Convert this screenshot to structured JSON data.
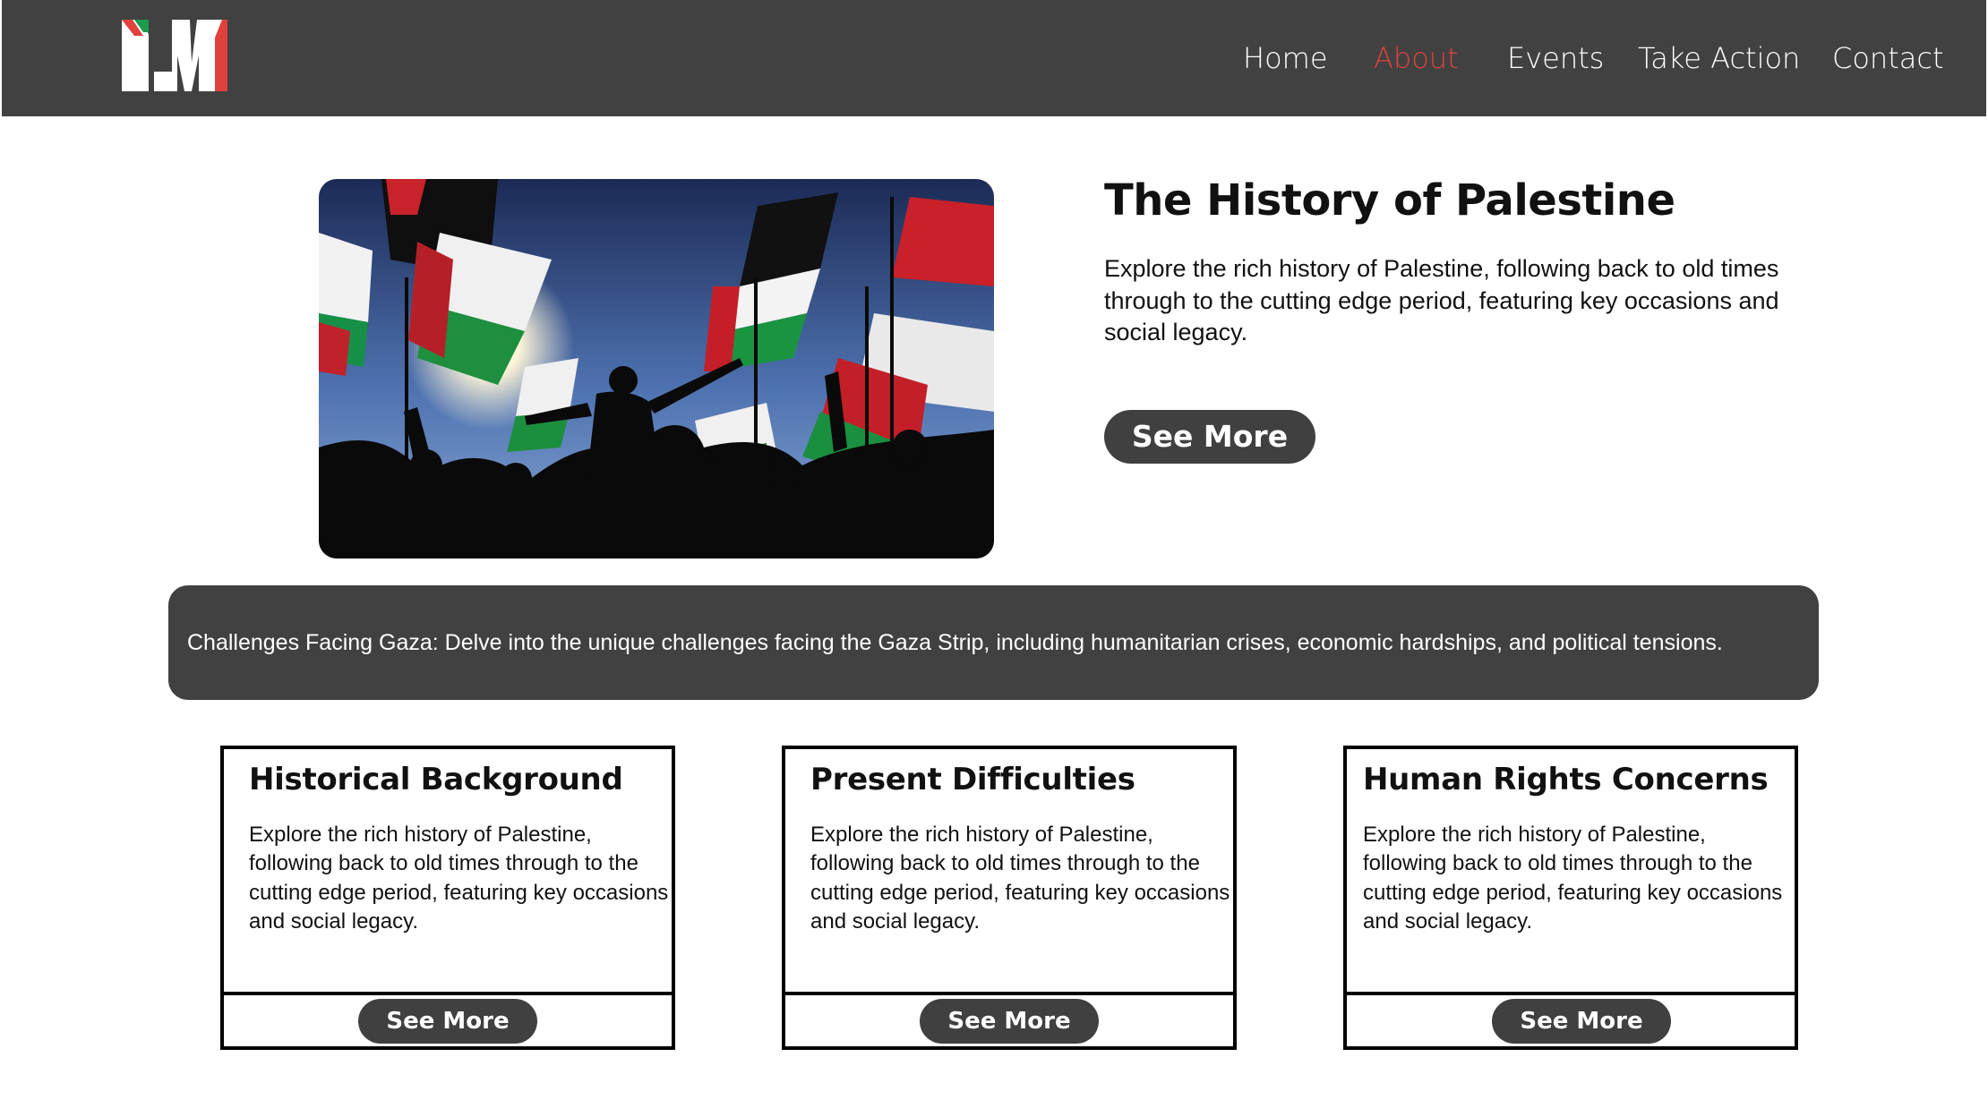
{
  "brand": {
    "logo_text": "IM",
    "colors": {
      "nav_bg": "#414141",
      "accent_red": "#e0413d",
      "flag_green": "#1a9c4a",
      "dark": "#404040"
    }
  },
  "nav": {
    "items": [
      {
        "label": "Home",
        "active": false
      },
      {
        "label": "About",
        "active": true
      },
      {
        "label": "Events",
        "active": false
      },
      {
        "label": "Take Action",
        "active": false
      },
      {
        "label": "Contact",
        "active": false
      }
    ]
  },
  "hero": {
    "image_icon": "palestinian-flags-photo",
    "title": "The History of Palestine",
    "text": "Explore the rich history of Palestine, following back to old times through to the cutting edge period, featuring key occasions and social legacy.",
    "button_label": "See More"
  },
  "banner": {
    "text": "Challenges Facing Gaza: Delve into the unique challenges facing the Gaza Strip, including humanitarian crises, economic hardships, and political tensions."
  },
  "cards": [
    {
      "title": "Historical Background",
      "text": "Explore the rich history of Palestine, following back to old times through to the cutting edge period, featuring key occasions and social legacy.",
      "button_label": "See More"
    },
    {
      "title": "Present Difficulties",
      "text": "Explore the rich history of Palestine, following back to old times through to the cutting edge period, featuring key occasions and social legacy.",
      "button_label": "See More"
    },
    {
      "title": "Human Rights Concerns",
      "text": "Explore the rich history of Palestine, following back to old times through to the cutting edge period, featuring key occasions and social legacy.",
      "button_label": "See More"
    }
  ]
}
